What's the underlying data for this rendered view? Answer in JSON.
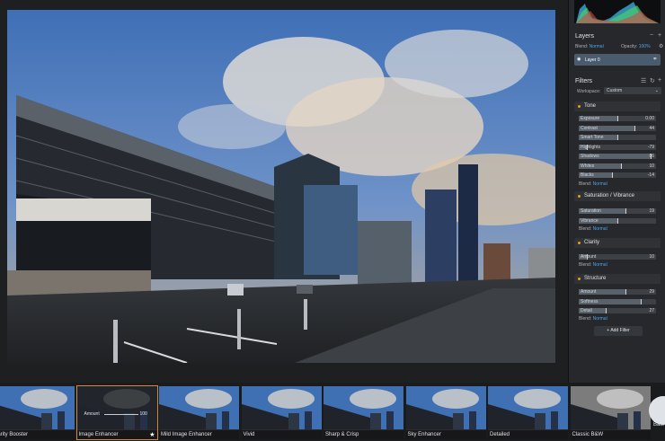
{
  "layers": {
    "title": "Layers",
    "blend_label": "Blend:",
    "blend_value": "Normal",
    "opacity_label": "Opacity:",
    "opacity_value": "100%",
    "layer_name": "Layer 0"
  },
  "filters": {
    "title": "Filters",
    "workspace_label": "Workspace:",
    "workspace_value": "Custom",
    "add_filter": "+ Add Filter",
    "sections": [
      {
        "name": "Tone",
        "sliders": [
          {
            "label": "Exposure",
            "value": "0.00",
            "level": 0.5
          },
          {
            "label": "Contrast",
            "value": "44",
            "level": 0.72
          },
          {
            "label": "Smart Tone",
            "value": "",
            "level": 0.5
          },
          {
            "label": "Highlights",
            "value": "-79",
            "level": 0.1
          },
          {
            "label": "Shadows",
            "value": "86",
            "level": 0.93
          },
          {
            "label": "Whites",
            "value": "10",
            "level": 0.55
          },
          {
            "label": "Blacks",
            "value": "-14",
            "level": 0.43
          }
        ],
        "blend_value": "Normal"
      },
      {
        "name": "Saturation / Vibrance",
        "sliders": [
          {
            "label": "Saturation",
            "value": "19",
            "level": 0.6
          },
          {
            "label": "Vibrance",
            "value": "",
            "level": 0.5
          }
        ],
        "blend_value": "Normal"
      },
      {
        "name": "Clarity",
        "sliders": [
          {
            "label": "Amount",
            "value": "10",
            "level": 0.1
          }
        ],
        "blend_value": "Normal"
      },
      {
        "name": "Structure",
        "sliders": [
          {
            "label": "Amount",
            "value": "29",
            "level": 0.6
          },
          {
            "label": "Softness",
            "value": "",
            "level": 0.8
          },
          {
            "label": "Detail",
            "value": "27",
            "level": 0.35
          }
        ],
        "blend_value": "Normal"
      }
    ]
  },
  "presets": [
    {
      "label": "larity Booster"
    },
    {
      "label": "Image Enhancer",
      "amount_label": "Amount",
      "amount_value": "100",
      "selected": true
    },
    {
      "label": "Mild Image Enhancer"
    },
    {
      "label": "Vivid"
    },
    {
      "label": "Sharp & Crisp"
    },
    {
      "label": "Sky Enhancer"
    },
    {
      "label": "Detailed"
    },
    {
      "label": "Classic B&W"
    },
    {
      "label": "Basi"
    }
  ],
  "colors": {
    "accent": "#4ea4e8",
    "selected_border": "#d08a3a",
    "section_dot": "#e0a020"
  }
}
